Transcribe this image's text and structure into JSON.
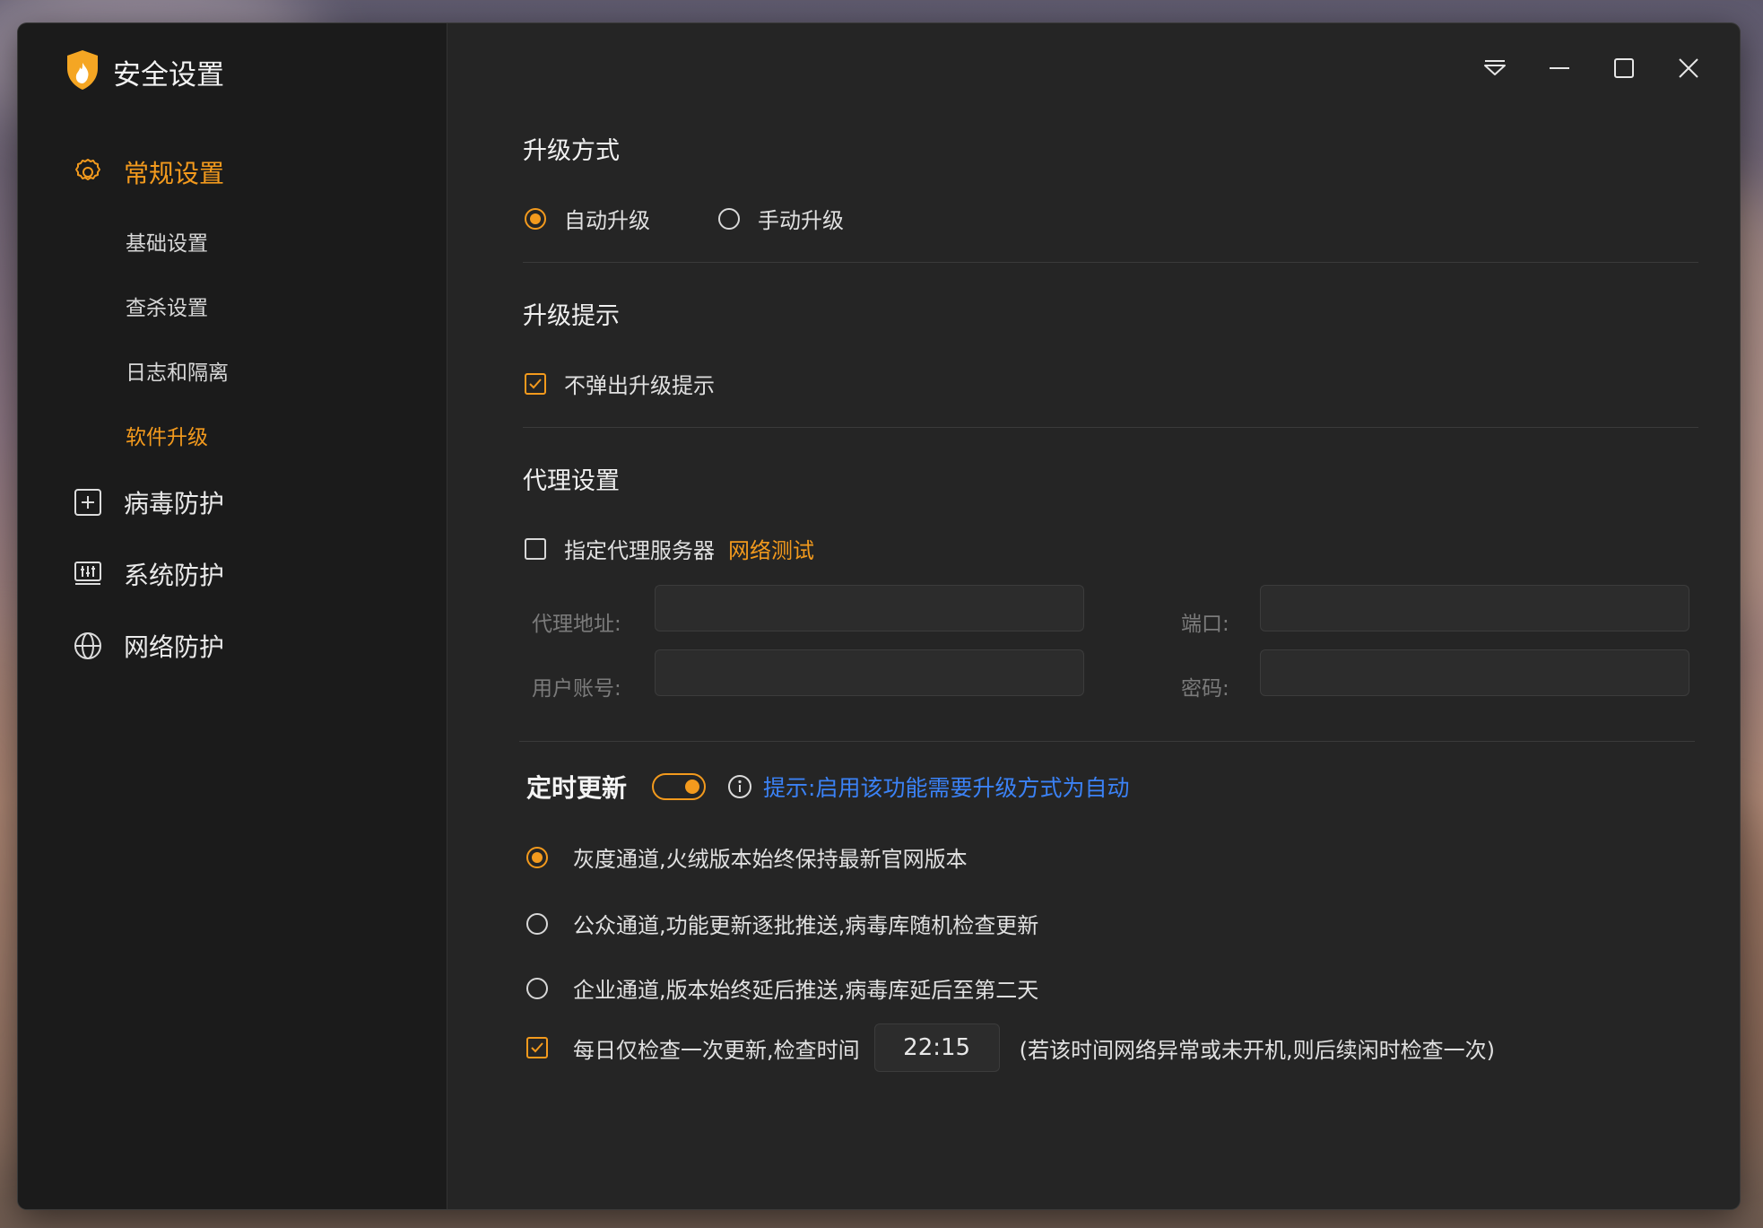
{
  "app": {
    "title": "安全设置"
  },
  "colors": {
    "accent": "#f39a1d",
    "hint_blue": "#3b82f6"
  },
  "sidebar": {
    "groups": [
      {
        "label": "常规设置",
        "icon": "gear-icon",
        "active": true,
        "items": [
          {
            "label": "基础设置",
            "active": false
          },
          {
            "label": "查杀设置",
            "active": false
          },
          {
            "label": "日志和隔离",
            "active": false
          },
          {
            "label": "软件升级",
            "active": true
          }
        ]
      },
      {
        "label": "病毒防护",
        "icon": "plus-square-icon",
        "active": false
      },
      {
        "label": "系统防护",
        "icon": "system-monitor-icon",
        "active": false
      },
      {
        "label": "网络防护",
        "icon": "globe-icon",
        "active": false
      }
    ]
  },
  "window_controls": [
    "menu-icon",
    "minimize-icon",
    "maximize-icon",
    "close-icon"
  ],
  "upgrade_method": {
    "title": "升级方式",
    "options": [
      {
        "label": "自动升级",
        "selected": true
      },
      {
        "label": "手动升级",
        "selected": false
      }
    ]
  },
  "upgrade_prompt": {
    "title": "升级提示",
    "no_popup": {
      "label": "不弹出升级提示",
      "checked": true
    }
  },
  "proxy": {
    "title": "代理设置",
    "specify": {
      "label": "指定代理服务器",
      "checked": false
    },
    "test_link": "网络测试",
    "address_label": "代理地址:",
    "address_value": "",
    "port_label": "端口:",
    "port_value": "",
    "user_label": "用户账号:",
    "user_value": "",
    "password_label": "密码:",
    "password_value": ""
  },
  "scheduled": {
    "title": "定时更新",
    "enabled": true,
    "hint": "提示:启用该功能需要升级方式为自动",
    "channels": [
      {
        "label": "灰度通道,火绒版本始终保持最新官网版本",
        "selected": true
      },
      {
        "label": "公众通道,功能更新逐批推送,病毒库随机检查更新",
        "selected": false
      },
      {
        "label": "企业通道,版本始终延后推送,病毒库延后至第二天",
        "selected": false
      }
    ],
    "daily_check": {
      "label": "每日仅检查一次更新,检查时间",
      "checked": true,
      "time": "22:15",
      "note": "(若该时间网络异常或未开机,则后续闲时检查一次)"
    }
  }
}
